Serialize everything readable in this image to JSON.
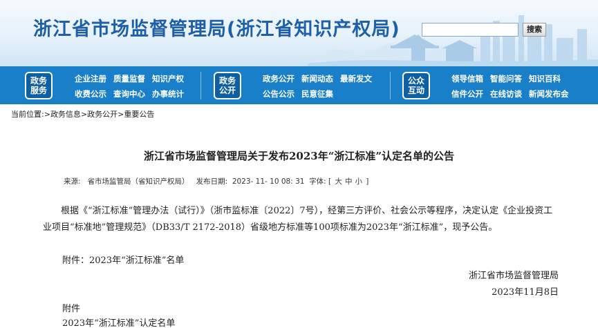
{
  "header": {
    "site_title": "浙江省市场监督管理局(浙江省知识产权局)",
    "search_placeholder": "",
    "search_button": "搜索"
  },
  "nav": {
    "groups": [
      {
        "badge_line1": "政务",
        "badge_line2": "服务",
        "links": [
          "企业注册",
          "质量监督",
          "知识产权",
          "收费公示",
          "查询中心",
          "办事统计"
        ]
      },
      {
        "badge_line1": "政务",
        "badge_line2": "公开",
        "links": [
          "政务公开",
          "新闻动态",
          "最新发文",
          "公告公示",
          "民意征集"
        ]
      },
      {
        "badge_line1": "公众",
        "badge_line2": "互动",
        "links": [
          "领导信箱",
          "智能问答",
          "知识百科",
          "信件公开",
          "在线访谈",
          "新闻发布会"
        ]
      }
    ]
  },
  "breadcrumb": {
    "prefix": "当前位置:",
    "items": [
      "政务信息",
      "政务公开",
      "重要公告"
    ],
    "separator": ">"
  },
  "article": {
    "title": "浙江省市场监督管理局关于发布2023年“浙江标准”认定名单的公告",
    "source_label": "来源:",
    "source": "省市场监管局（省知识产权局）",
    "date_label": "发布日期:",
    "date": "2023- 11- 10 08: 31",
    "font_label": "字体:",
    "font_sizes": [
      "大",
      "中",
      "小"
    ],
    "paragraph": "根据《“浙江标准”管理办法（试行）》（浙市监标准〔2022〕7号），经第三方评价、社会公示等程序，决定认定《企业投资工业项目“标准地”管理规范》（DB33/T 2172-2018）省级地方标准等100项标准为2023年“浙江标准”，现予公告。",
    "attachment_line": "附件：2023年“浙江标准”名单",
    "signature_org": "浙江省市场监督管理局",
    "signature_date": "2023年11月8日",
    "attachment_heading": "附件",
    "attachment_title": "2023年“浙江标准”认定名单"
  },
  "colors": {
    "nav_bg": "#1a7fc9",
    "badge_bg": "#0f5fa3",
    "title_blue": "#1d5fa8"
  }
}
